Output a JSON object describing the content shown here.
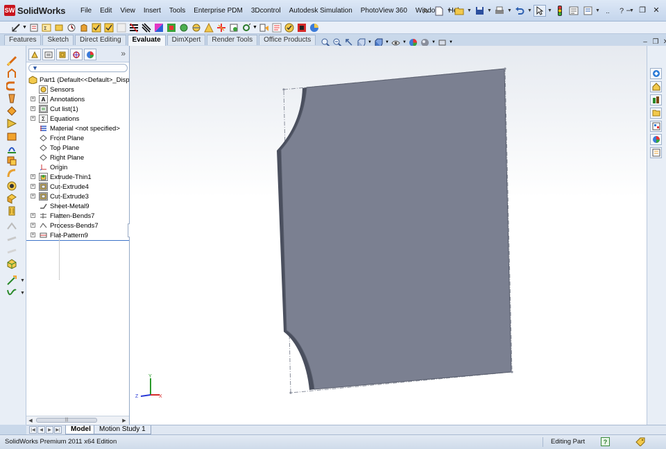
{
  "app": {
    "logo_badge": "SW",
    "logo_text": "SolidWorks",
    "menu": [
      "File",
      "Edit",
      "View",
      "Insert",
      "Tools",
      "Enterprise PDM",
      "3Dcontrol",
      "Autodesk Simulation",
      "PhotoView 360",
      "Window",
      "Help"
    ],
    "window_controls": {
      "minimize": "–",
      "restore": "❐",
      "close": "✕"
    }
  },
  "tabs": [
    {
      "label": "Features",
      "active": false
    },
    {
      "label": "Sketch",
      "active": false
    },
    {
      "label": "Direct Editing",
      "active": false
    },
    {
      "label": "Evaluate",
      "active": true
    },
    {
      "label": "DimXpert",
      "active": false
    },
    {
      "label": "Render Tools",
      "active": false
    },
    {
      "label": "Office Products",
      "active": false
    }
  ],
  "feature_tree": {
    "more": "»",
    "filter_icon": "▼",
    "root": "Part1  (Default<<Default>_Disp",
    "items": [
      {
        "label": "Sensors",
        "icon": "sensor-icon",
        "expandable": false
      },
      {
        "label": "Annotations",
        "icon": "annotations-icon",
        "expandable": true
      },
      {
        "label": "Cut list(1)",
        "icon": "cut-list-icon",
        "expandable": true
      },
      {
        "label": "Equations",
        "icon": "equations-icon",
        "expandable": true
      },
      {
        "label": "Material <not specified>",
        "icon": "material-icon",
        "expandable": false
      },
      {
        "label": "Front Plane",
        "icon": "plane-icon",
        "expandable": false
      },
      {
        "label": "Top Plane",
        "icon": "plane-icon",
        "expandable": false
      },
      {
        "label": "Right Plane",
        "icon": "plane-icon",
        "expandable": false
      },
      {
        "label": "Origin",
        "icon": "origin-icon",
        "expandable": false
      },
      {
        "label": "Extrude-Thin1",
        "icon": "extrude-icon",
        "expandable": true
      },
      {
        "label": "Cut-Extrude4",
        "icon": "cut-extrude-icon",
        "expandable": true
      },
      {
        "label": "Cut-Extrude3",
        "icon": "cut-extrude-icon",
        "expandable": true
      },
      {
        "label": "Sheet-Metal9",
        "icon": "sheet-metal-icon",
        "expandable": false
      },
      {
        "label": "Flatten-Bends7",
        "icon": "flatten-bends-icon",
        "expandable": true
      },
      {
        "label": "Process-Bends7",
        "icon": "process-bends-icon",
        "expandable": true
      },
      {
        "label": "Flat-Pattern9",
        "icon": "flat-pattern-icon",
        "expandable": true
      }
    ],
    "scroll_thumb": "|||"
  },
  "bottom_tabs": [
    {
      "label": "Model",
      "active": true
    },
    {
      "label": "Motion Study 1",
      "active": false
    }
  ],
  "status": {
    "edition": "SolidWorks Premium 2011 x64 Edition",
    "mode": "Editing Part",
    "help": "?"
  },
  "triad": {
    "x": "X",
    "y": "Y",
    "z": "Z"
  },
  "colors": {
    "part_face": "#7b8091",
    "part_edge": "#4a4f5e",
    "accent": "#3d73c8"
  }
}
